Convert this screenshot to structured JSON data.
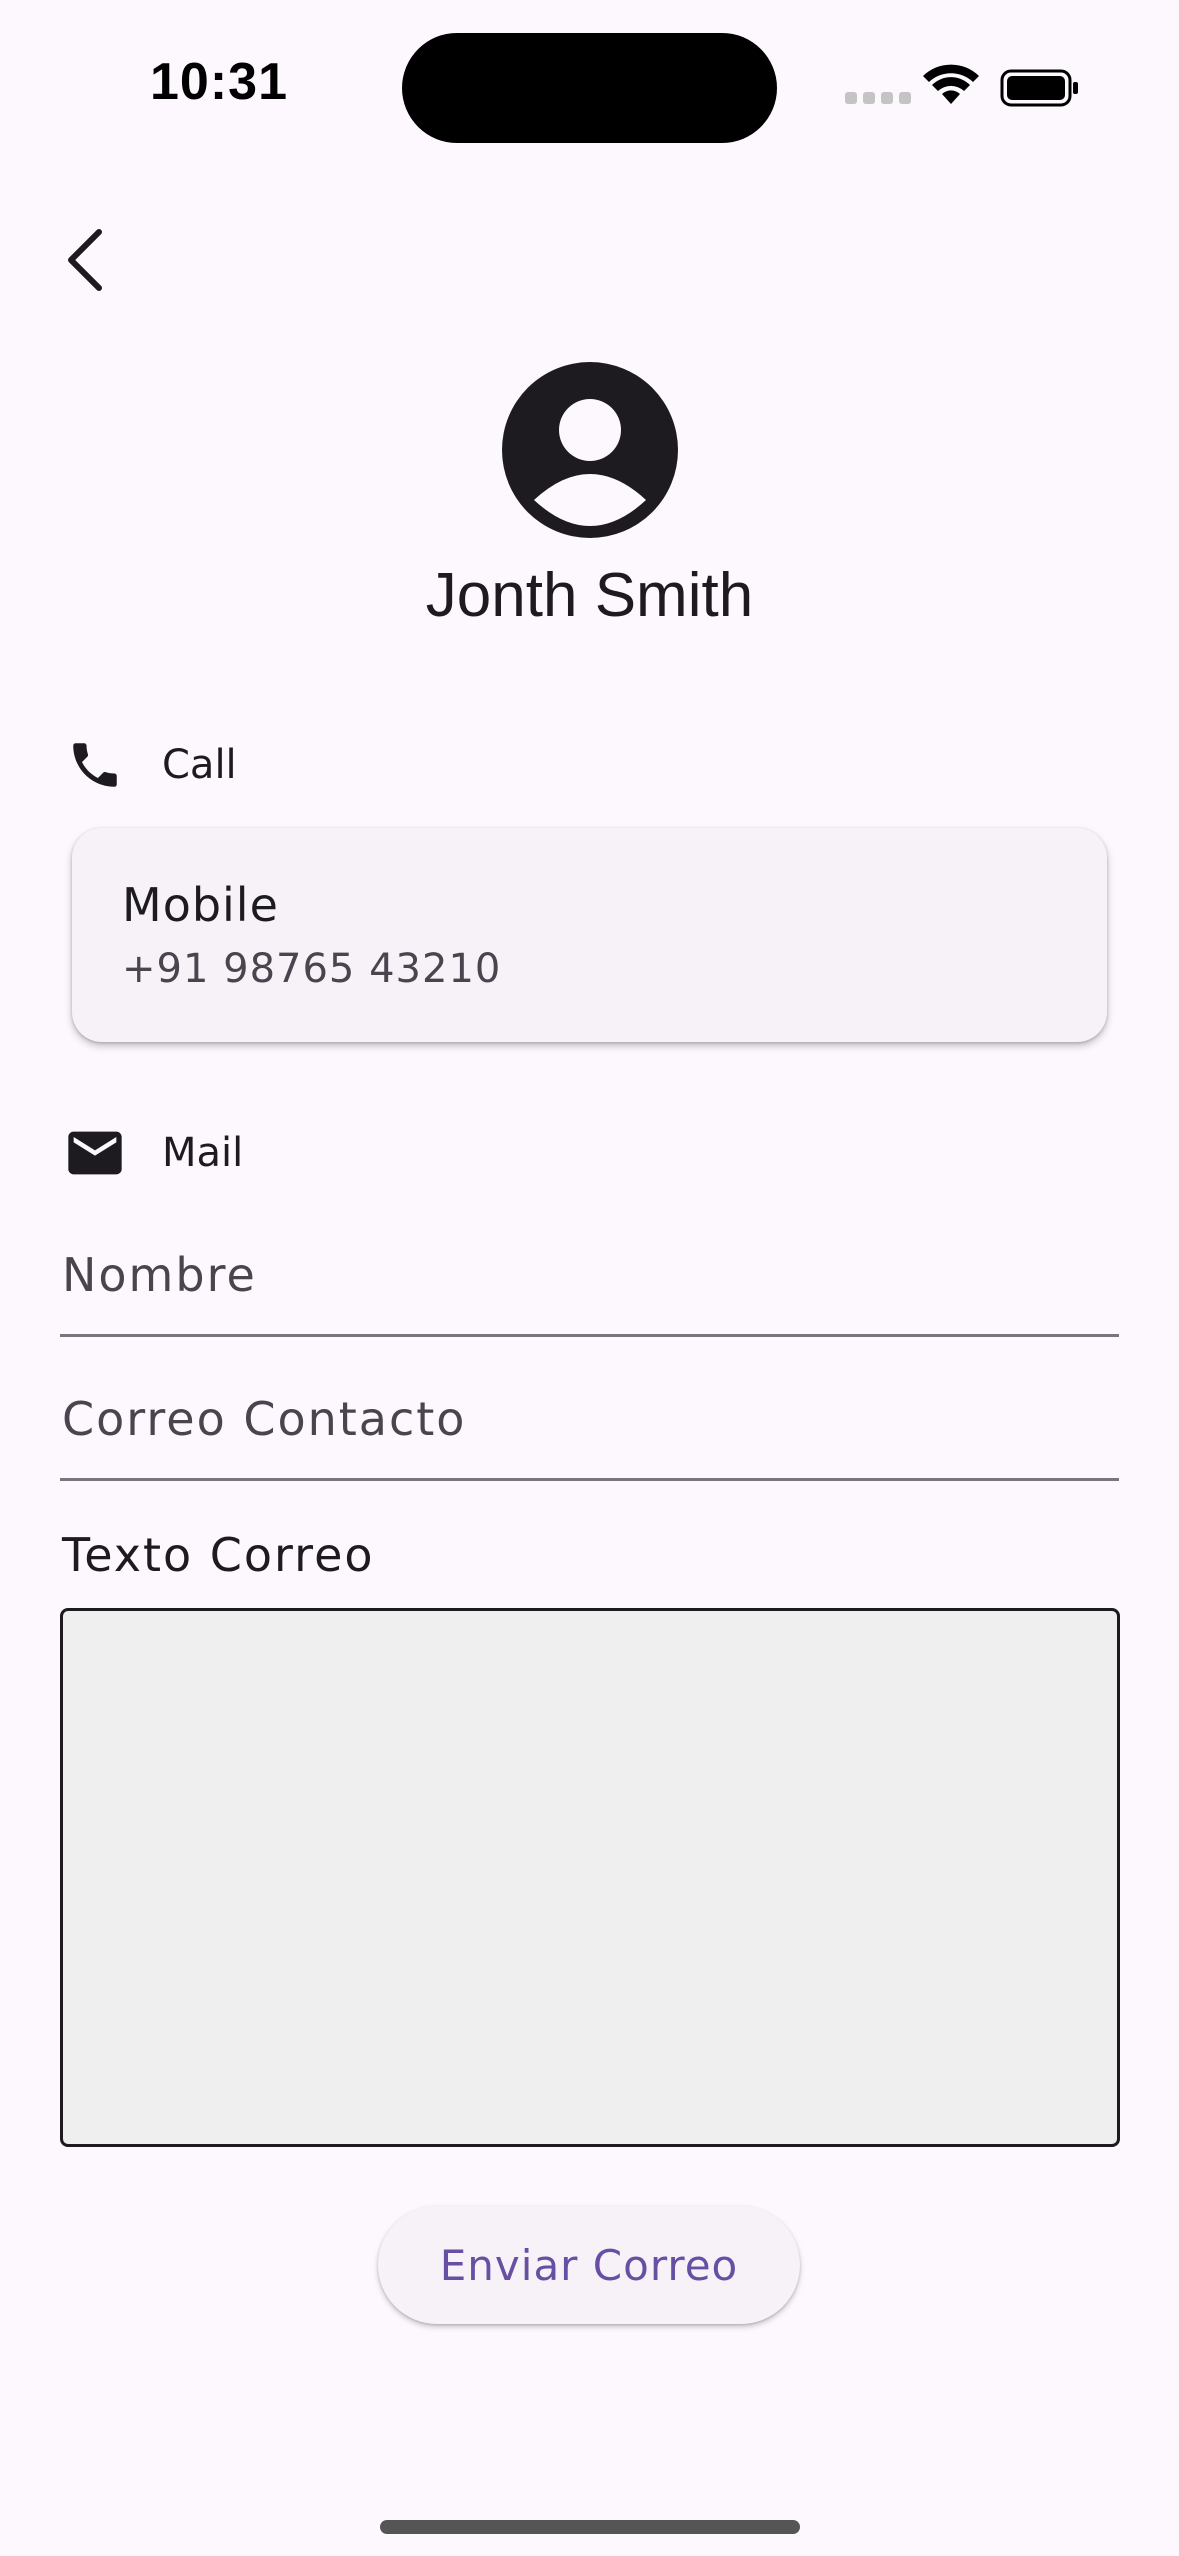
{
  "status_bar": {
    "time": "10:31"
  },
  "contact": {
    "name": "Jonth Smith"
  },
  "call_section": {
    "label": "Call",
    "phone": {
      "type": "Mobile",
      "number": "+91 98765 43210"
    }
  },
  "mail_section": {
    "label": "Mail",
    "name_placeholder": "Nombre",
    "email_placeholder": "Correo Contacto",
    "body_label": "Texto Correo",
    "body_value": "",
    "send_label": "Enviar Correo"
  },
  "icons": {
    "back": "chevron-left-icon",
    "avatar": "account-circle-icon",
    "phone": "phone-icon",
    "mail": "mail-icon"
  },
  "colors": {
    "background": "#fdf7fe",
    "accent": "#6750a4",
    "card": "#f6f2f8",
    "textarea": "#efefef"
  }
}
